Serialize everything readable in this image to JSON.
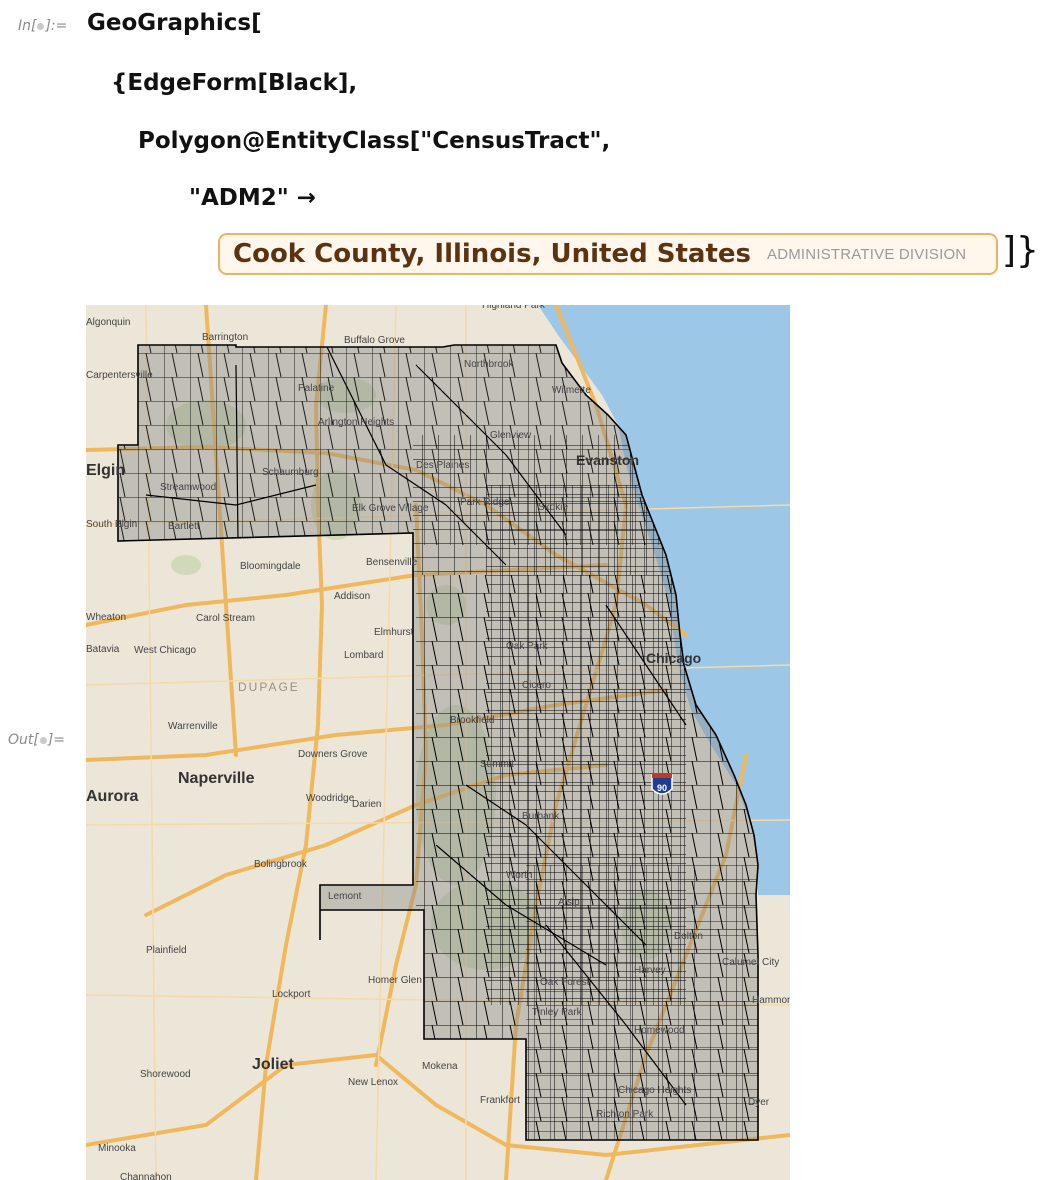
{
  "notebook": {
    "in_label_prefix": "In[",
    "in_label_suffix": "]:=",
    "out_label_prefix": "Out[",
    "out_label_suffix": "]=",
    "code": {
      "line1": "GeoGraphics[",
      "line2": "{EdgeForm[Black],",
      "line3": "Polygon@EntityClass[\"CensusTract\",",
      "line4": "\"ADM2\" →",
      "line5_close": "]}]"
    },
    "entity": {
      "name": "Cook County, Illinois, United States",
      "type": "ADMINISTRATIVE DIVISION"
    }
  },
  "map": {
    "colors": {
      "land": "#ebe6d8",
      "water": "#9cc7e6",
      "highway": "#f0b85c",
      "tract_fill": "#8a8a8a",
      "tract_edge": "#000000",
      "green": "#b9cf9f"
    },
    "places": [
      {
        "name": "Algonquin"
      },
      {
        "name": "Barrington"
      },
      {
        "name": "Buffalo Grove"
      },
      {
        "name": "Highland Park"
      },
      {
        "name": "Carpentersville"
      },
      {
        "name": "Palatine"
      },
      {
        "name": "Northbrook"
      },
      {
        "name": "Wilmette"
      },
      {
        "name": "Arlington Heights"
      },
      {
        "name": "Glenview"
      },
      {
        "name": "Evanston"
      },
      {
        "name": "Elgin"
      },
      {
        "name": "Streamwood"
      },
      {
        "name": "Schaumburg"
      },
      {
        "name": "Des Plaines"
      },
      {
        "name": "Park Ridge"
      },
      {
        "name": "Skokie"
      },
      {
        "name": "South Elgin"
      },
      {
        "name": "Bartlett"
      },
      {
        "name": "Elk Grove Village"
      },
      {
        "name": "Bloomingdale"
      },
      {
        "name": "Bensenville"
      },
      {
        "name": "Addison"
      },
      {
        "name": "Carol Stream"
      },
      {
        "name": "Elmhurst"
      },
      {
        "name": "Wheaton"
      },
      {
        "name": "West Chicago"
      },
      {
        "name": "Lombard"
      },
      {
        "name": "Chicago"
      },
      {
        "name": "DUPAGE"
      },
      {
        "name": "Oak Park"
      },
      {
        "name": "Cicero"
      },
      {
        "name": "Batavia"
      },
      {
        "name": "Warrenville"
      },
      {
        "name": "Brookfield"
      },
      {
        "name": "Aurora"
      },
      {
        "name": "Downers Grove"
      },
      {
        "name": "Naperville"
      },
      {
        "name": "Summit"
      },
      {
        "name": "Woodridge"
      },
      {
        "name": "Darien"
      },
      {
        "name": "Burbank"
      },
      {
        "name": "Bolingbrook"
      },
      {
        "name": "Worth"
      },
      {
        "name": "Lemont"
      },
      {
        "name": "Alsip"
      },
      {
        "name": "Plainfield"
      },
      {
        "name": "Dolton"
      },
      {
        "name": "Calumet City"
      },
      {
        "name": "Harvey"
      },
      {
        "name": "Homer Glen"
      },
      {
        "name": "Oak Forest"
      },
      {
        "name": "Lockport"
      },
      {
        "name": "Hammond"
      },
      {
        "name": "Tinley Park"
      },
      {
        "name": "Homewood"
      },
      {
        "name": "Joliet"
      },
      {
        "name": "Shorewood"
      },
      {
        "name": "Mokena"
      },
      {
        "name": "New Lenox"
      },
      {
        "name": "Chicago Heights"
      },
      {
        "name": "Frankfort"
      },
      {
        "name": "Richton Park"
      },
      {
        "name": "Dyer"
      },
      {
        "name": "Minooka"
      },
      {
        "name": "Channahon"
      }
    ],
    "interstate_shield": "90"
  }
}
